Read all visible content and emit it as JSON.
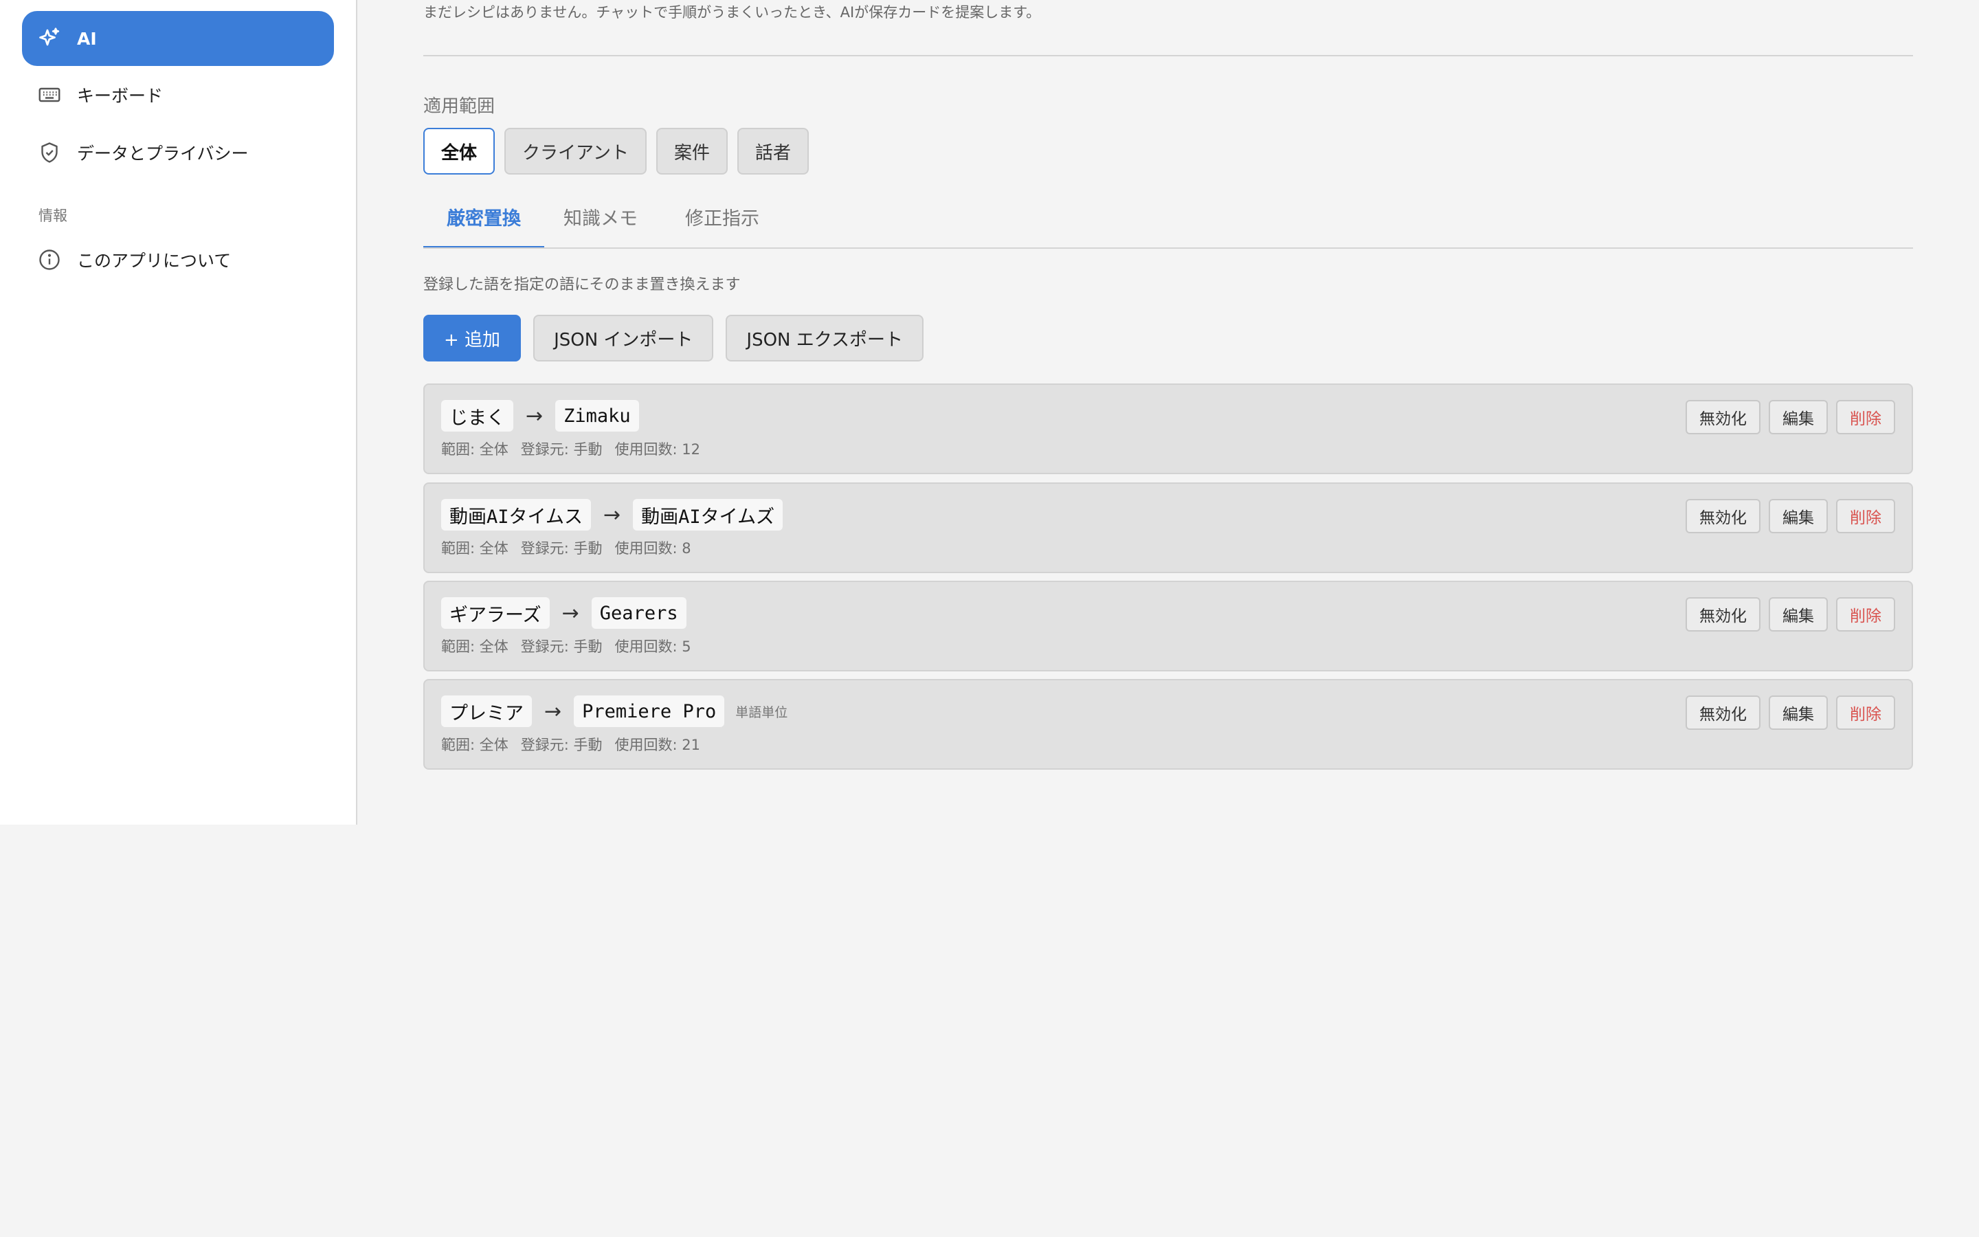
{
  "sidebar": {
    "items": [
      {
        "label": "AI",
        "icon": "sparkles-icon",
        "active": true
      },
      {
        "label": "キーボード",
        "icon": "keyboard-icon"
      },
      {
        "label": "データとプライバシー",
        "icon": "shield-icon"
      }
    ],
    "section_info": "情報",
    "about": {
      "label": "このアプリについて",
      "icon": "info-icon"
    }
  },
  "main": {
    "recipe_hint": "まだレシピはありません。チャットで手順がうまくいったとき、AIが保存カードを提案します。",
    "scope_title": "適用範囲",
    "scopes": [
      "全体",
      "クライアント",
      "案件",
      "話者"
    ],
    "active_scope": "全体",
    "tabs": [
      "厳密置換",
      "知識メモ",
      "修正指示"
    ],
    "active_tab": "厳密置換",
    "description": "登録した語を指定の語にそのまま置き換えます",
    "actions": {
      "add": "+ 追加",
      "import": "JSON インポート",
      "export": "JSON エクスポート"
    },
    "arrow": "→",
    "row_buttons": {
      "disable": "無効化",
      "edit": "編集",
      "delete": "削除"
    },
    "rules": [
      {
        "from": "じまく",
        "to": "Zimaku",
        "tag": "",
        "scope": "範囲: 全体",
        "source": "登録元: 手動",
        "uses": "使用回数: 12"
      },
      {
        "from": "動画AIタイムス",
        "to": "動画AIタイムズ",
        "tag": "",
        "scope": "範囲: 全体",
        "source": "登録元: 手動",
        "uses": "使用回数: 8"
      },
      {
        "from": "ギアラーズ",
        "to": "Gearers",
        "tag": "",
        "scope": "範囲: 全体",
        "source": "登録元: 手動",
        "uses": "使用回数: 5"
      },
      {
        "from": "プレミア",
        "to": "Premiere Pro",
        "tag": "単語単位",
        "scope": "範囲: 全体",
        "source": "登録元: 手動",
        "uses": "使用回数: 21"
      }
    ]
  },
  "colors": {
    "accent": "#3b7dd8",
    "danger": "#d9534f"
  }
}
